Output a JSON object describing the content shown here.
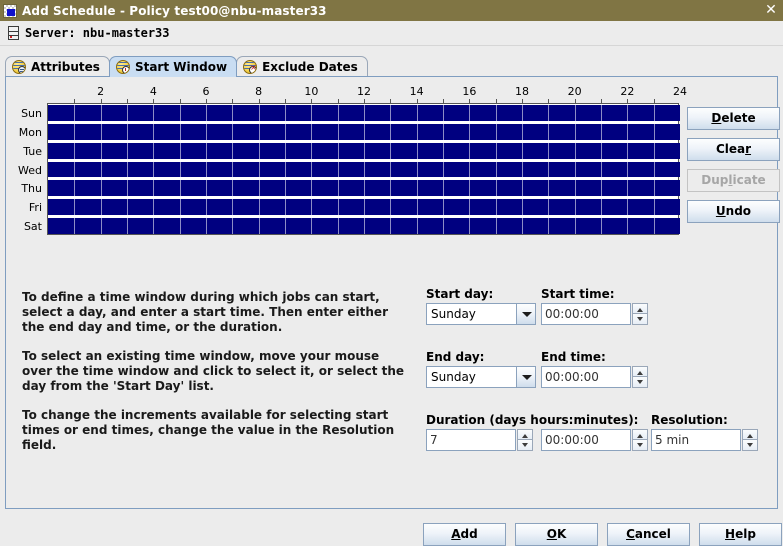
{
  "window": {
    "title": "Add Schedule - Policy test00@nbu-master33",
    "icon": "window-icon",
    "close_label": "✕"
  },
  "server": {
    "icon": "server-icon",
    "text": "Server: nbu-master33"
  },
  "tabs": [
    {
      "label": "Attributes",
      "icon": "globe-lines-icon",
      "badge": "lines",
      "selected": false
    },
    {
      "label": "Start Window",
      "icon": "globe-clock-icon",
      "badge": "clock",
      "selected": true
    },
    {
      "label": "Exclude Dates",
      "icon": "globe-cross-icon",
      "badge": "cross",
      "selected": false
    }
  ],
  "schedule_grid": {
    "days": [
      "Sun",
      "Mon",
      "Tue",
      "Wed",
      "Thu",
      "Fri",
      "Sat"
    ],
    "hour_labels": [
      "2",
      "4",
      "6",
      "8",
      "10",
      "12",
      "14",
      "16",
      "18",
      "20",
      "22",
      "24"
    ],
    "hour_label_values": [
      2,
      4,
      6,
      8,
      10,
      12,
      14,
      16,
      18,
      20,
      22,
      24
    ],
    "hours_total": 24,
    "filled_color": "#000080",
    "background_color": "#ffffff",
    "windows": [
      {
        "day": "Sun",
        "start": "00:00:00",
        "end": "24:00:00"
      },
      {
        "day": "Mon",
        "start": "00:00:00",
        "end": "24:00:00"
      },
      {
        "day": "Tue",
        "start": "00:00:00",
        "end": "24:00:00"
      },
      {
        "day": "Wed",
        "start": "00:00:00",
        "end": "24:00:00"
      },
      {
        "day": "Thu",
        "start": "00:00:00",
        "end": "24:00:00"
      },
      {
        "day": "Fri",
        "start": "00:00:00",
        "end": "24:00:00"
      },
      {
        "day": "Sat",
        "start": "00:00:00",
        "end": "24:00:00"
      }
    ]
  },
  "side_buttons": [
    {
      "label": "Delete",
      "mnemonic": "D",
      "enabled": true
    },
    {
      "label": "Clear",
      "mnemonic": "r",
      "enabled": true
    },
    {
      "label": "Duplicate",
      "mnemonic": "l",
      "enabled": false
    },
    {
      "label": "Undo",
      "mnemonic": "U",
      "enabled": true
    }
  ],
  "instructions": [
    "To define a time window during which jobs can start, select a day, and enter a start time. Then enter either the end day and time, or the duration.",
    "To select an existing time window, move your mouse over the time window and click to select it, or select the day from the 'Start Day' list.",
    "To change the increments available for selecting start times or end times, change the value in the Resolution field."
  ],
  "form": {
    "start_day": {
      "label": "Start day:",
      "value": "Sunday"
    },
    "start_time": {
      "label": "Start time:",
      "value": "00:00:00"
    },
    "end_day": {
      "label": "End day:",
      "value": "Sunday"
    },
    "end_time": {
      "label": "End time:",
      "value": "00:00:00"
    },
    "duration": {
      "label": "Duration (days hours:minutes):",
      "days": "7",
      "time": "00:00:00"
    },
    "resolution": {
      "label": "Resolution:",
      "value": "5 min"
    }
  },
  "bottom_buttons": [
    {
      "label": "Add",
      "mnemonic": "A"
    },
    {
      "label": "OK",
      "mnemonic": "O"
    },
    {
      "label": "Cancel",
      "mnemonic": "C"
    },
    {
      "label": "Help",
      "mnemonic": "H"
    }
  ],
  "colors": {
    "titlebar": "#807544",
    "panel_background": "#ececec",
    "grid_fill": "#000080",
    "selected_tab": "#c9ddf2",
    "panel_border": "#7f9dc0"
  }
}
